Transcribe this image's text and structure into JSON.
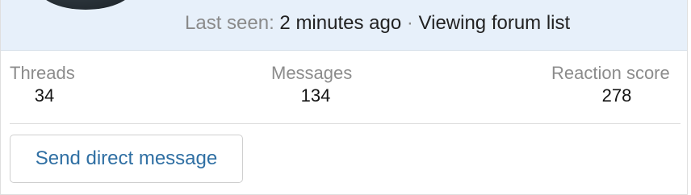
{
  "header": {
    "last_seen_label": "Last seen:",
    "last_seen_value": "2 minutes ago",
    "separator": "·",
    "activity": "Viewing forum list"
  },
  "stats": [
    {
      "label": "Threads",
      "value": "34"
    },
    {
      "label": "Messages",
      "value": "134"
    },
    {
      "label": "Reaction score",
      "value": "278"
    }
  ],
  "actions": {
    "direct_message_label": "Send direct message"
  },
  "colors": {
    "header_bg": "#e7f0fa",
    "link": "#2f6fa3",
    "muted_text": "#8c8c8c"
  }
}
